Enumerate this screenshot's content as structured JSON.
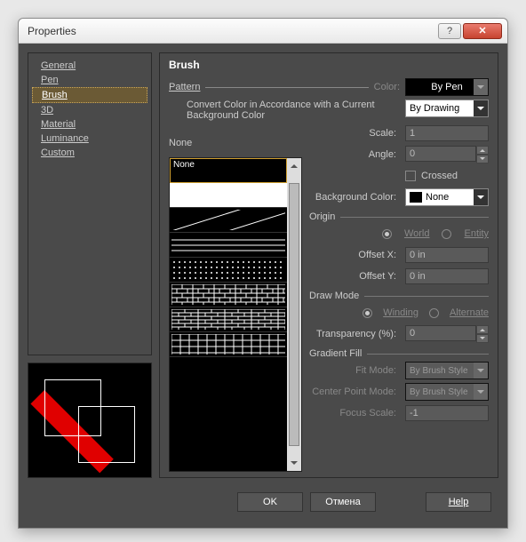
{
  "window": {
    "title": "Properties"
  },
  "nav": {
    "items": [
      {
        "label": "General"
      },
      {
        "label": "Pen"
      },
      {
        "label": "Brush"
      },
      {
        "label": "3D"
      },
      {
        "label": "Material"
      },
      {
        "label": "Luminance"
      },
      {
        "label": "Custom"
      }
    ],
    "selected_index": 2
  },
  "panel": {
    "heading": "Brush",
    "pattern_label": "Pattern",
    "color_label": "Color:",
    "color_value": "By Pen",
    "convert_text": "Convert Color in Accordance with a Current Background Color",
    "convert_value": "By Drawing",
    "pattern_preview_label": "None",
    "pattern_list_first": "None",
    "scale": {
      "label": "Scale:",
      "value": "1"
    },
    "angle": {
      "label": "Angle:",
      "value": "0"
    },
    "crossed_label": "Crossed",
    "bgcolor": {
      "label": "Background Color:",
      "value": "None"
    },
    "origin": {
      "label": "Origin",
      "world": "World",
      "entity": "Entity",
      "offset_x_label": "Offset X:",
      "offset_x_value": "0 in",
      "offset_y_label": "Offset Y:",
      "offset_y_value": "0 in"
    },
    "drawmode": {
      "label": "Draw Mode",
      "winding": "Winding",
      "alternate": "Alternate"
    },
    "transparency": {
      "label": "Transparency (%):",
      "value": "0"
    },
    "gradient": {
      "label": "Gradient Fill",
      "fit_label": "Fit Mode:",
      "fit_value": "By Brush Style",
      "center_label": "Center Point Mode:",
      "center_value": "By Brush Style",
      "focus_label": "Focus Scale:",
      "focus_value": "-1"
    }
  },
  "buttons": {
    "ok": "OK",
    "cancel": "Отмена",
    "help": "Help"
  }
}
